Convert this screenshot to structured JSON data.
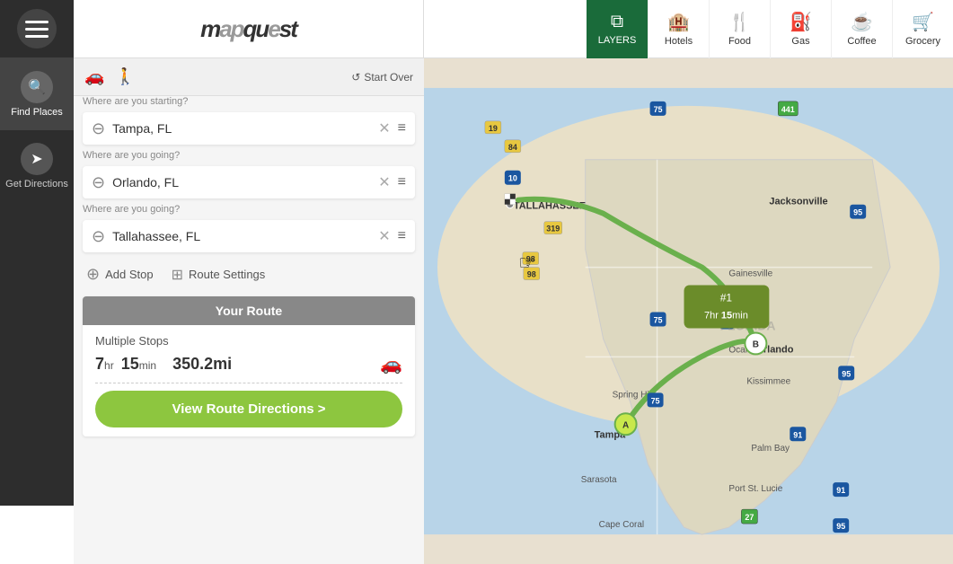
{
  "sidebar": {
    "menu_label": "Menu",
    "logo_text": "mapquest",
    "nav_items": [
      {
        "id": "find-places",
        "label": "Find Places",
        "icon": "🔍",
        "active": true
      },
      {
        "id": "get-directions",
        "label": "Get Directions",
        "icon": "➤",
        "active": false
      }
    ]
  },
  "toolbar": {
    "logo": "mapquest",
    "items": [
      {
        "id": "layers",
        "label": "LAYERS",
        "icon": "⧉",
        "active": true
      },
      {
        "id": "hotels",
        "label": "Hotels",
        "icon": "🏨",
        "active": false
      },
      {
        "id": "food",
        "label": "Food",
        "icon": "🍴",
        "active": false
      },
      {
        "id": "gas",
        "label": "Gas",
        "icon": "⛽",
        "active": false
      },
      {
        "id": "coffee",
        "label": "Coffee",
        "icon": "☕",
        "active": false
      },
      {
        "id": "grocery",
        "label": "Grocery",
        "icon": "🛒",
        "active": false
      }
    ]
  },
  "panel": {
    "transport_modes": [
      "car",
      "walk"
    ],
    "start_over_label": "Start Over",
    "waypoints": [
      {
        "id": "start",
        "label": "Where are you starting?",
        "value": "Tampa, FL"
      },
      {
        "id": "dest1",
        "label": "Where are you going?",
        "value": "Orlando, FL"
      },
      {
        "id": "dest2",
        "label": "Where are you going?",
        "value": "Tallahassee, FL"
      }
    ],
    "add_stop_label": "Add Stop",
    "route_settings_label": "Route Settings",
    "route_summary": {
      "header": "Your Route",
      "multiple_stops": "Multiple Stops",
      "hours": "7",
      "minutes": "15",
      "distance": "350.2mi",
      "hr_label": "hr",
      "min_label": "min"
    },
    "view_route_btn": "View Route Directions >"
  },
  "route_bubble": {
    "number": "#1",
    "time": "7hr 15min"
  },
  "map": {
    "collapse_arrow": "◀"
  }
}
